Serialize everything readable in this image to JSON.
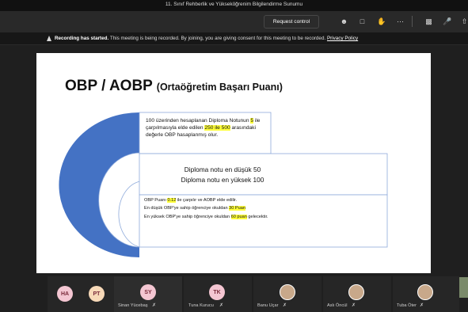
{
  "window": {
    "title": "11. Sınıf Rehberlik ve Yükseköğrenim Bilgilendirme Sunumu"
  },
  "toolbar": {
    "request_control": "Request control",
    "icons": [
      "people-icon",
      "chat-icon",
      "react-icon",
      "more-icon",
      "camera-off-icon",
      "mic-off-icon",
      "share-icon"
    ]
  },
  "banner": {
    "bold": "Recording has started.",
    "message": "This meeting is being recorded. By joining, you are giving consent for this meeting to be recorded.",
    "link": "Privacy Policy"
  },
  "slide": {
    "title": "OBP / AOBP",
    "subtitle": "(Ortaöğretim Başarı Puanı)",
    "box1": {
      "a": "100 üzerinden hesaplanan Diploma Notunun ",
      "b": "5",
      "c": " ile çarpılmasıyla elde edilen ",
      "d": "250 ile 500",
      "e": " arasındaki değerle OBP hasaplanmış olur."
    },
    "box2": {
      "line1": "Diploma notu en düşük 50",
      "line2": "Diploma notu en yüksek 100"
    },
    "box3": {
      "p1a": "OBP Puanı ",
      "p1b": "0.12",
      "p1c": " ile çarpılır ve AOBP elde edilir.",
      "p2a": "En düşük OBP'ye sahip öğrenciye okuldan ",
      "p2b": "30 Puan",
      "p2c": "",
      "p3a": "En yüksek OBP'ye sahip öğrenciye okuldan ",
      "p3b": "60 puan",
      "p3c": " gelecektir."
    },
    "colors": {
      "arc": "#4472c4",
      "frame": "#8eaadb",
      "highlight": "#ffff3a"
    }
  },
  "participants": [
    {
      "initials": "HA",
      "name": "",
      "color": "#f4c6d2"
    },
    {
      "initials": "PT",
      "name": "",
      "color": "#f7d9b8"
    },
    {
      "initials": "SY",
      "name": "Sinan Yücebaş",
      "color": "#f4c6d2"
    },
    {
      "initials": "TK",
      "name": "Tuna Kurucu",
      "color": "#f4c6d2"
    },
    {
      "initials": "",
      "name": "Banu Uçar",
      "color": "#c8a88a"
    },
    {
      "initials": "",
      "name": "Aslı Öncül",
      "color": "#c8a88a"
    },
    {
      "initials": "",
      "name": "Tuba Öter",
      "color": "#c8a88a"
    }
  ]
}
